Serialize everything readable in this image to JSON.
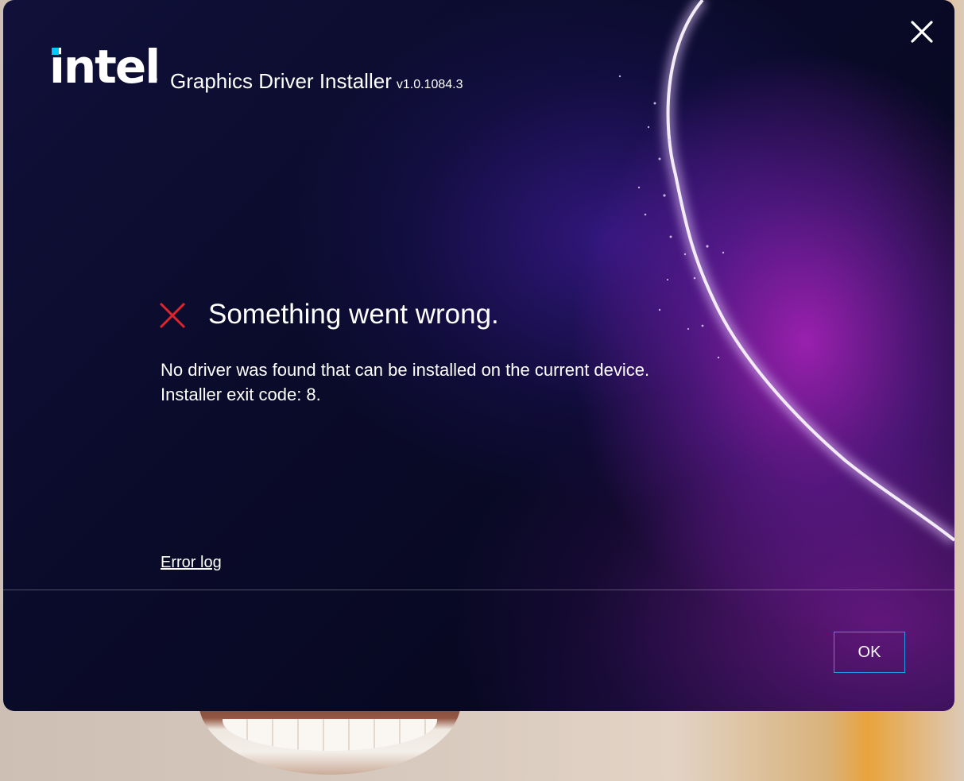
{
  "brand": {
    "logo_text": "intel",
    "logo_accent_color": "#00c7fd",
    "registered_mark": "®"
  },
  "window": {
    "title": "Graphics Driver Installer",
    "version": "v1.0.1084.3",
    "close_icon": "close-icon"
  },
  "error": {
    "icon": "error-x-icon",
    "icon_color": "#e0242b",
    "title": "Something went wrong.",
    "message_line1": "No driver was found that can be installed on the current device.",
    "message_line2": "Installer exit code: 8.",
    "error_log_link": "Error log"
  },
  "footer": {
    "ok_label": "OK",
    "ok_border_color": "#1aa3ea"
  }
}
